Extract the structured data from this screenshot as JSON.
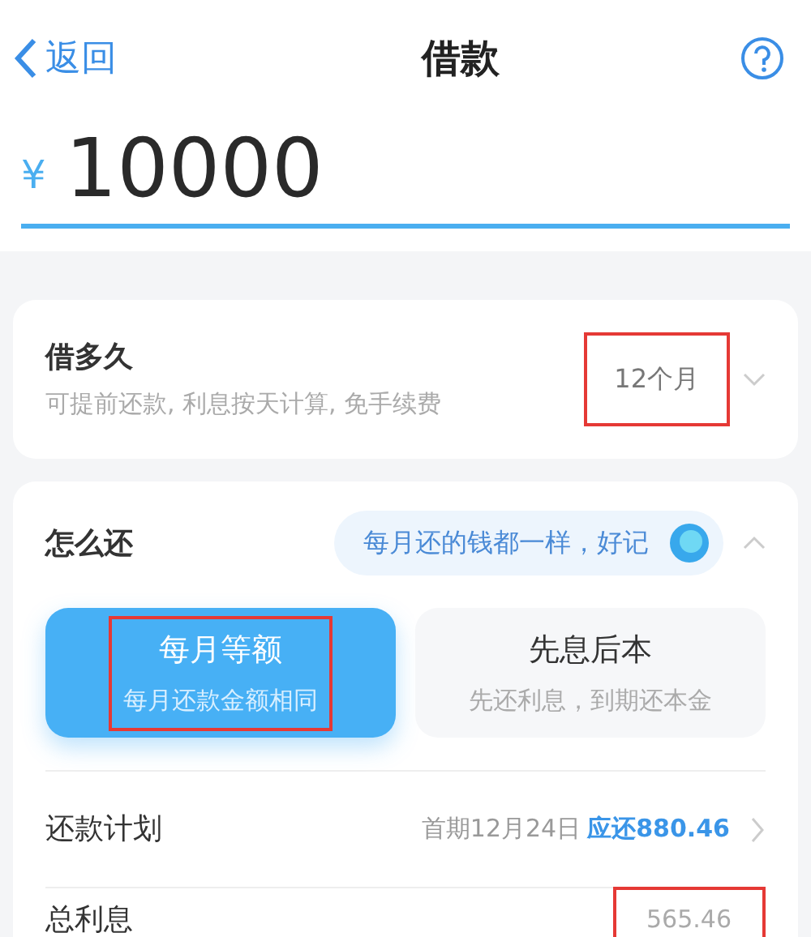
{
  "header": {
    "back": "返回",
    "title": "借款"
  },
  "amount": {
    "currency": "¥",
    "value": "10000"
  },
  "term": {
    "label": "借多久",
    "hint": "可提前还款, 利息按天计算, 免手续费",
    "value": "12个月",
    "highlighted": true
  },
  "repay": {
    "label": "怎么还",
    "tip": "每月还的钱都一样，好记",
    "expanded": true,
    "options": [
      {
        "title": "每月等额",
        "subtitle": "每月还款金额相同",
        "selected": true,
        "highlighted": true
      },
      {
        "title": "先息后本",
        "subtitle": "先还利息，到期还本金",
        "selected": false,
        "highlighted": false
      }
    ],
    "plan": {
      "label": "还款计划",
      "first": "首期12月24日",
      "due": "应还880.46"
    },
    "interest": {
      "label": "总利息",
      "value": "565.46",
      "highlighted": true
    }
  }
}
